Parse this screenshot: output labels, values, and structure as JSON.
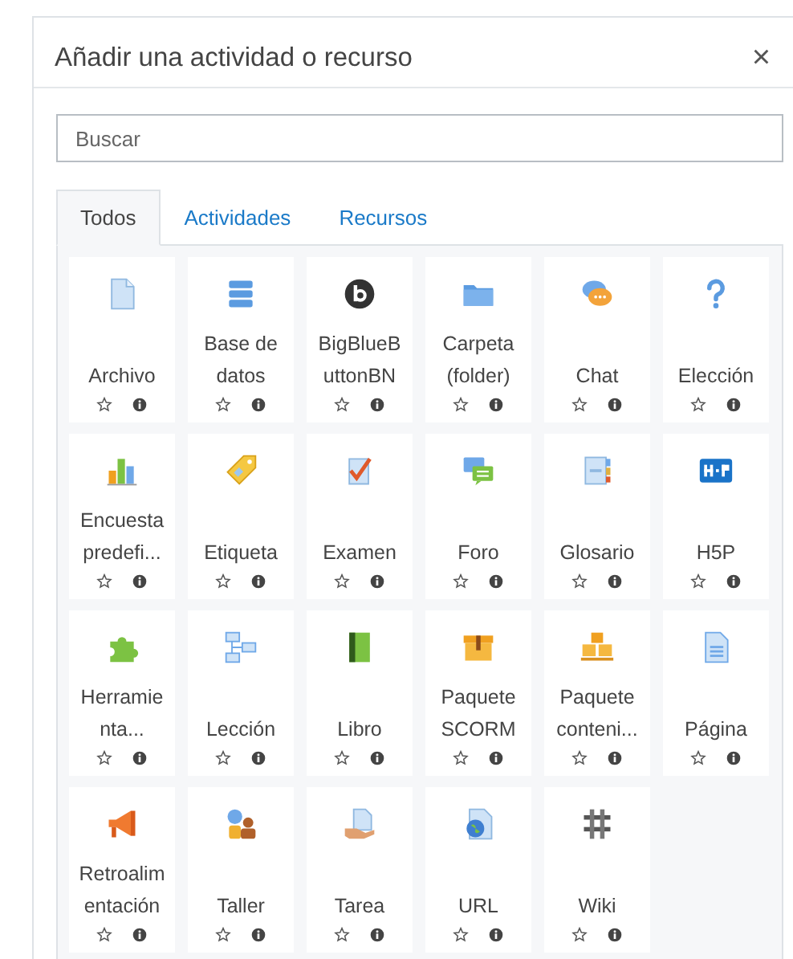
{
  "dialog": {
    "title": "Añadir una actividad o recurso",
    "close": "×"
  },
  "search": {
    "placeholder": "Buscar"
  },
  "tabs": [
    {
      "label": "Todos",
      "selected": true
    },
    {
      "label": "Actividades",
      "selected": false
    },
    {
      "label": "Recursos",
      "selected": false
    }
  ],
  "items": [
    {
      "lines": [
        "Archivo"
      ],
      "kind": "file"
    },
    {
      "lines": [
        "Base de",
        "datos"
      ],
      "kind": "database"
    },
    {
      "lines": [
        "BigBlueB",
        "uttonBN"
      ],
      "kind": "bbb"
    },
    {
      "lines": [
        "Carpeta",
        "(folder)"
      ],
      "kind": "folder"
    },
    {
      "lines": [
        "Chat"
      ],
      "kind": "chat"
    },
    {
      "lines": [
        "Elección"
      ],
      "kind": "question"
    },
    {
      "lines": [
        "Encuesta",
        "predefi..."
      ],
      "kind": "chart"
    },
    {
      "lines": [
        "Etiqueta"
      ],
      "kind": "tag"
    },
    {
      "lines": [
        "Examen"
      ],
      "kind": "quiz"
    },
    {
      "lines": [
        "Foro"
      ],
      "kind": "forum"
    },
    {
      "lines": [
        "Glosario"
      ],
      "kind": "glossary"
    },
    {
      "lines": [
        "H5P"
      ],
      "kind": "h5p"
    },
    {
      "lines": [
        "Herramie",
        "nta..."
      ],
      "kind": "puzzle"
    },
    {
      "lines": [
        "Lección"
      ],
      "kind": "lesson"
    },
    {
      "lines": [
        "Libro"
      ],
      "kind": "book"
    },
    {
      "lines": [
        "Paquete",
        "SCORM"
      ],
      "kind": "box"
    },
    {
      "lines": [
        "Paquete",
        "conteni..."
      ],
      "kind": "boxes"
    },
    {
      "lines": [
        "Página"
      ],
      "kind": "page"
    },
    {
      "lines": [
        "Retroalim",
        "entación"
      ],
      "kind": "megaphone"
    },
    {
      "lines": [
        "Taller"
      ],
      "kind": "people"
    },
    {
      "lines": [
        "Tarea"
      ],
      "kind": "assignment"
    },
    {
      "lines": [
        "URL"
      ],
      "kind": "url"
    },
    {
      "lines": [
        "Wiki"
      ],
      "kind": "wiki"
    }
  ]
}
